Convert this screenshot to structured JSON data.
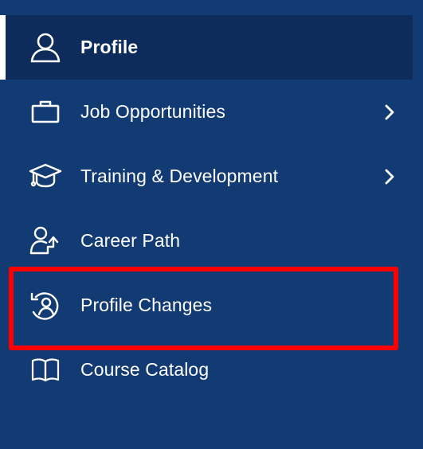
{
  "nav": {
    "items": [
      {
        "label": "Profile",
        "icon": "user-icon",
        "active": true,
        "has_submenu": false
      },
      {
        "label": "Job Opportunities",
        "icon": "briefcase-icon",
        "active": false,
        "has_submenu": true
      },
      {
        "label": "Training & Development",
        "icon": "graduation-cap-icon",
        "active": false,
        "has_submenu": true
      },
      {
        "label": "Career Path",
        "icon": "career-path-icon",
        "active": false,
        "has_submenu": false
      },
      {
        "label": "Profile Changes",
        "icon": "profile-history-icon",
        "active": false,
        "has_submenu": false
      },
      {
        "label": "Course Catalog",
        "icon": "book-icon",
        "active": false,
        "has_submenu": false
      }
    ]
  },
  "highlight": {
    "target": "Profile Changes",
    "color": "#ff0000"
  },
  "colors": {
    "sidebar_bg": "#123a73",
    "active_bg": "#0d2c5c",
    "text": "#ffffff",
    "highlight": "#ff0000"
  }
}
